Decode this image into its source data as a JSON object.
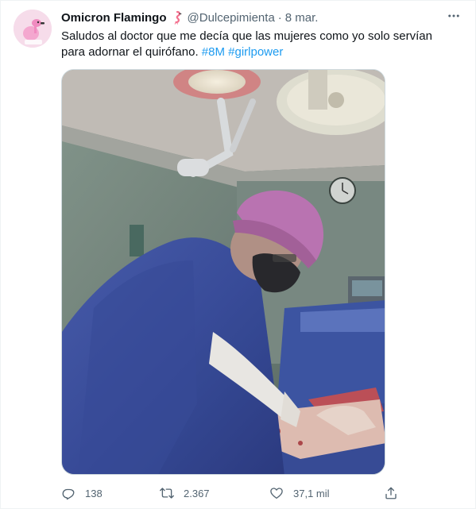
{
  "tweet": {
    "display_name": "Omicron Flamingo",
    "handle": "@Dulcepimienta",
    "separator": "·",
    "time": "8 mar.",
    "text_main": "Saludos al doctor que me decía que las mujeres como yo solo servían para adornar el quirófano.",
    "hashtags": [
      "#8M",
      "#girlpower"
    ],
    "name_emoji": "flamingo-emoji",
    "media_alt": "Photo of a surgeon in scrubs and pink cap operating"
  },
  "actions": {
    "reply_count": "138",
    "retweet_count": "2.367",
    "like_count": "37,1 mil"
  },
  "icons": {
    "more": "more-horizontal-icon",
    "reply": "reply-icon",
    "retweet": "retweet-icon",
    "like": "heart-icon",
    "share": "share-icon"
  },
  "colors": {
    "text": "#0f1419",
    "secondary": "#536471",
    "link": "#1d9bf0"
  }
}
